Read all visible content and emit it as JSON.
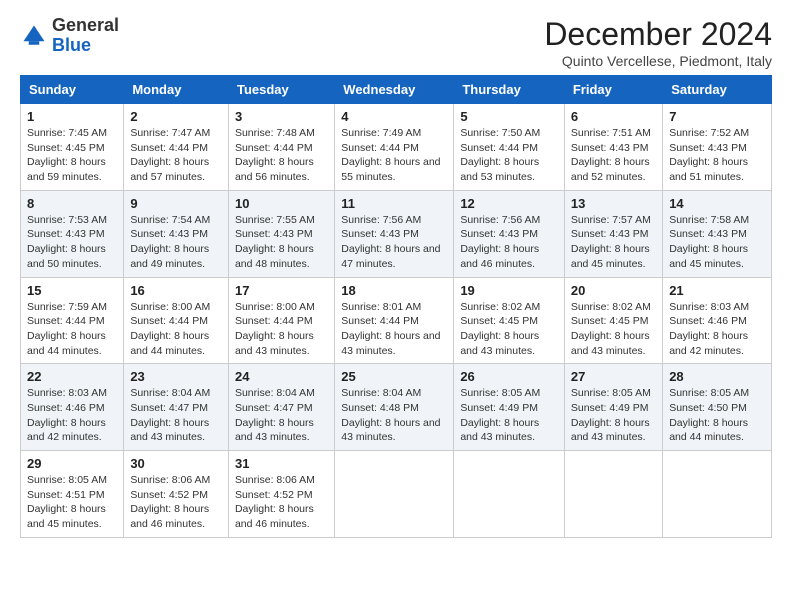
{
  "logo": {
    "general": "General",
    "blue": "Blue"
  },
  "title": "December 2024",
  "location": "Quinto Vercellese, Piedmont, Italy",
  "days_of_week": [
    "Sunday",
    "Monday",
    "Tuesday",
    "Wednesday",
    "Thursday",
    "Friday",
    "Saturday"
  ],
  "weeks": [
    [
      {
        "day": "1",
        "sunrise": "7:45 AM",
        "sunset": "4:45 PM",
        "daylight": "8 hours and 59 minutes."
      },
      {
        "day": "2",
        "sunrise": "7:47 AM",
        "sunset": "4:44 PM",
        "daylight": "8 hours and 57 minutes."
      },
      {
        "day": "3",
        "sunrise": "7:48 AM",
        "sunset": "4:44 PM",
        "daylight": "8 hours and 56 minutes."
      },
      {
        "day": "4",
        "sunrise": "7:49 AM",
        "sunset": "4:44 PM",
        "daylight": "8 hours and 55 minutes."
      },
      {
        "day": "5",
        "sunrise": "7:50 AM",
        "sunset": "4:44 PM",
        "daylight": "8 hours and 53 minutes."
      },
      {
        "day": "6",
        "sunrise": "7:51 AM",
        "sunset": "4:43 PM",
        "daylight": "8 hours and 52 minutes."
      },
      {
        "day": "7",
        "sunrise": "7:52 AM",
        "sunset": "4:43 PM",
        "daylight": "8 hours and 51 minutes."
      }
    ],
    [
      {
        "day": "8",
        "sunrise": "7:53 AM",
        "sunset": "4:43 PM",
        "daylight": "8 hours and 50 minutes."
      },
      {
        "day": "9",
        "sunrise": "7:54 AM",
        "sunset": "4:43 PM",
        "daylight": "8 hours and 49 minutes."
      },
      {
        "day": "10",
        "sunrise": "7:55 AM",
        "sunset": "4:43 PM",
        "daylight": "8 hours and 48 minutes."
      },
      {
        "day": "11",
        "sunrise": "7:56 AM",
        "sunset": "4:43 PM",
        "daylight": "8 hours and 47 minutes."
      },
      {
        "day": "12",
        "sunrise": "7:56 AM",
        "sunset": "4:43 PM",
        "daylight": "8 hours and 46 minutes."
      },
      {
        "day": "13",
        "sunrise": "7:57 AM",
        "sunset": "4:43 PM",
        "daylight": "8 hours and 45 minutes."
      },
      {
        "day": "14",
        "sunrise": "7:58 AM",
        "sunset": "4:43 PM",
        "daylight": "8 hours and 45 minutes."
      }
    ],
    [
      {
        "day": "15",
        "sunrise": "7:59 AM",
        "sunset": "4:44 PM",
        "daylight": "8 hours and 44 minutes."
      },
      {
        "day": "16",
        "sunrise": "8:00 AM",
        "sunset": "4:44 PM",
        "daylight": "8 hours and 44 minutes."
      },
      {
        "day": "17",
        "sunrise": "8:00 AM",
        "sunset": "4:44 PM",
        "daylight": "8 hours and 43 minutes."
      },
      {
        "day": "18",
        "sunrise": "8:01 AM",
        "sunset": "4:44 PM",
        "daylight": "8 hours and 43 minutes."
      },
      {
        "day": "19",
        "sunrise": "8:02 AM",
        "sunset": "4:45 PM",
        "daylight": "8 hours and 43 minutes."
      },
      {
        "day": "20",
        "sunrise": "8:02 AM",
        "sunset": "4:45 PM",
        "daylight": "8 hours and 43 minutes."
      },
      {
        "day": "21",
        "sunrise": "8:03 AM",
        "sunset": "4:46 PM",
        "daylight": "8 hours and 42 minutes."
      }
    ],
    [
      {
        "day": "22",
        "sunrise": "8:03 AM",
        "sunset": "4:46 PM",
        "daylight": "8 hours and 42 minutes."
      },
      {
        "day": "23",
        "sunrise": "8:04 AM",
        "sunset": "4:47 PM",
        "daylight": "8 hours and 43 minutes."
      },
      {
        "day": "24",
        "sunrise": "8:04 AM",
        "sunset": "4:47 PM",
        "daylight": "8 hours and 43 minutes."
      },
      {
        "day": "25",
        "sunrise": "8:04 AM",
        "sunset": "4:48 PM",
        "daylight": "8 hours and 43 minutes."
      },
      {
        "day": "26",
        "sunrise": "8:05 AM",
        "sunset": "4:49 PM",
        "daylight": "8 hours and 43 minutes."
      },
      {
        "day": "27",
        "sunrise": "8:05 AM",
        "sunset": "4:49 PM",
        "daylight": "8 hours and 43 minutes."
      },
      {
        "day": "28",
        "sunrise": "8:05 AM",
        "sunset": "4:50 PM",
        "daylight": "8 hours and 44 minutes."
      }
    ],
    [
      {
        "day": "29",
        "sunrise": "8:05 AM",
        "sunset": "4:51 PM",
        "daylight": "8 hours and 45 minutes."
      },
      {
        "day": "30",
        "sunrise": "8:06 AM",
        "sunset": "4:52 PM",
        "daylight": "8 hours and 46 minutes."
      },
      {
        "day": "31",
        "sunrise": "8:06 AM",
        "sunset": "4:52 PM",
        "daylight": "8 hours and 46 minutes."
      },
      null,
      null,
      null,
      null
    ]
  ],
  "labels": {
    "sunrise": "Sunrise:",
    "sunset": "Sunset:",
    "daylight": "Daylight:"
  }
}
